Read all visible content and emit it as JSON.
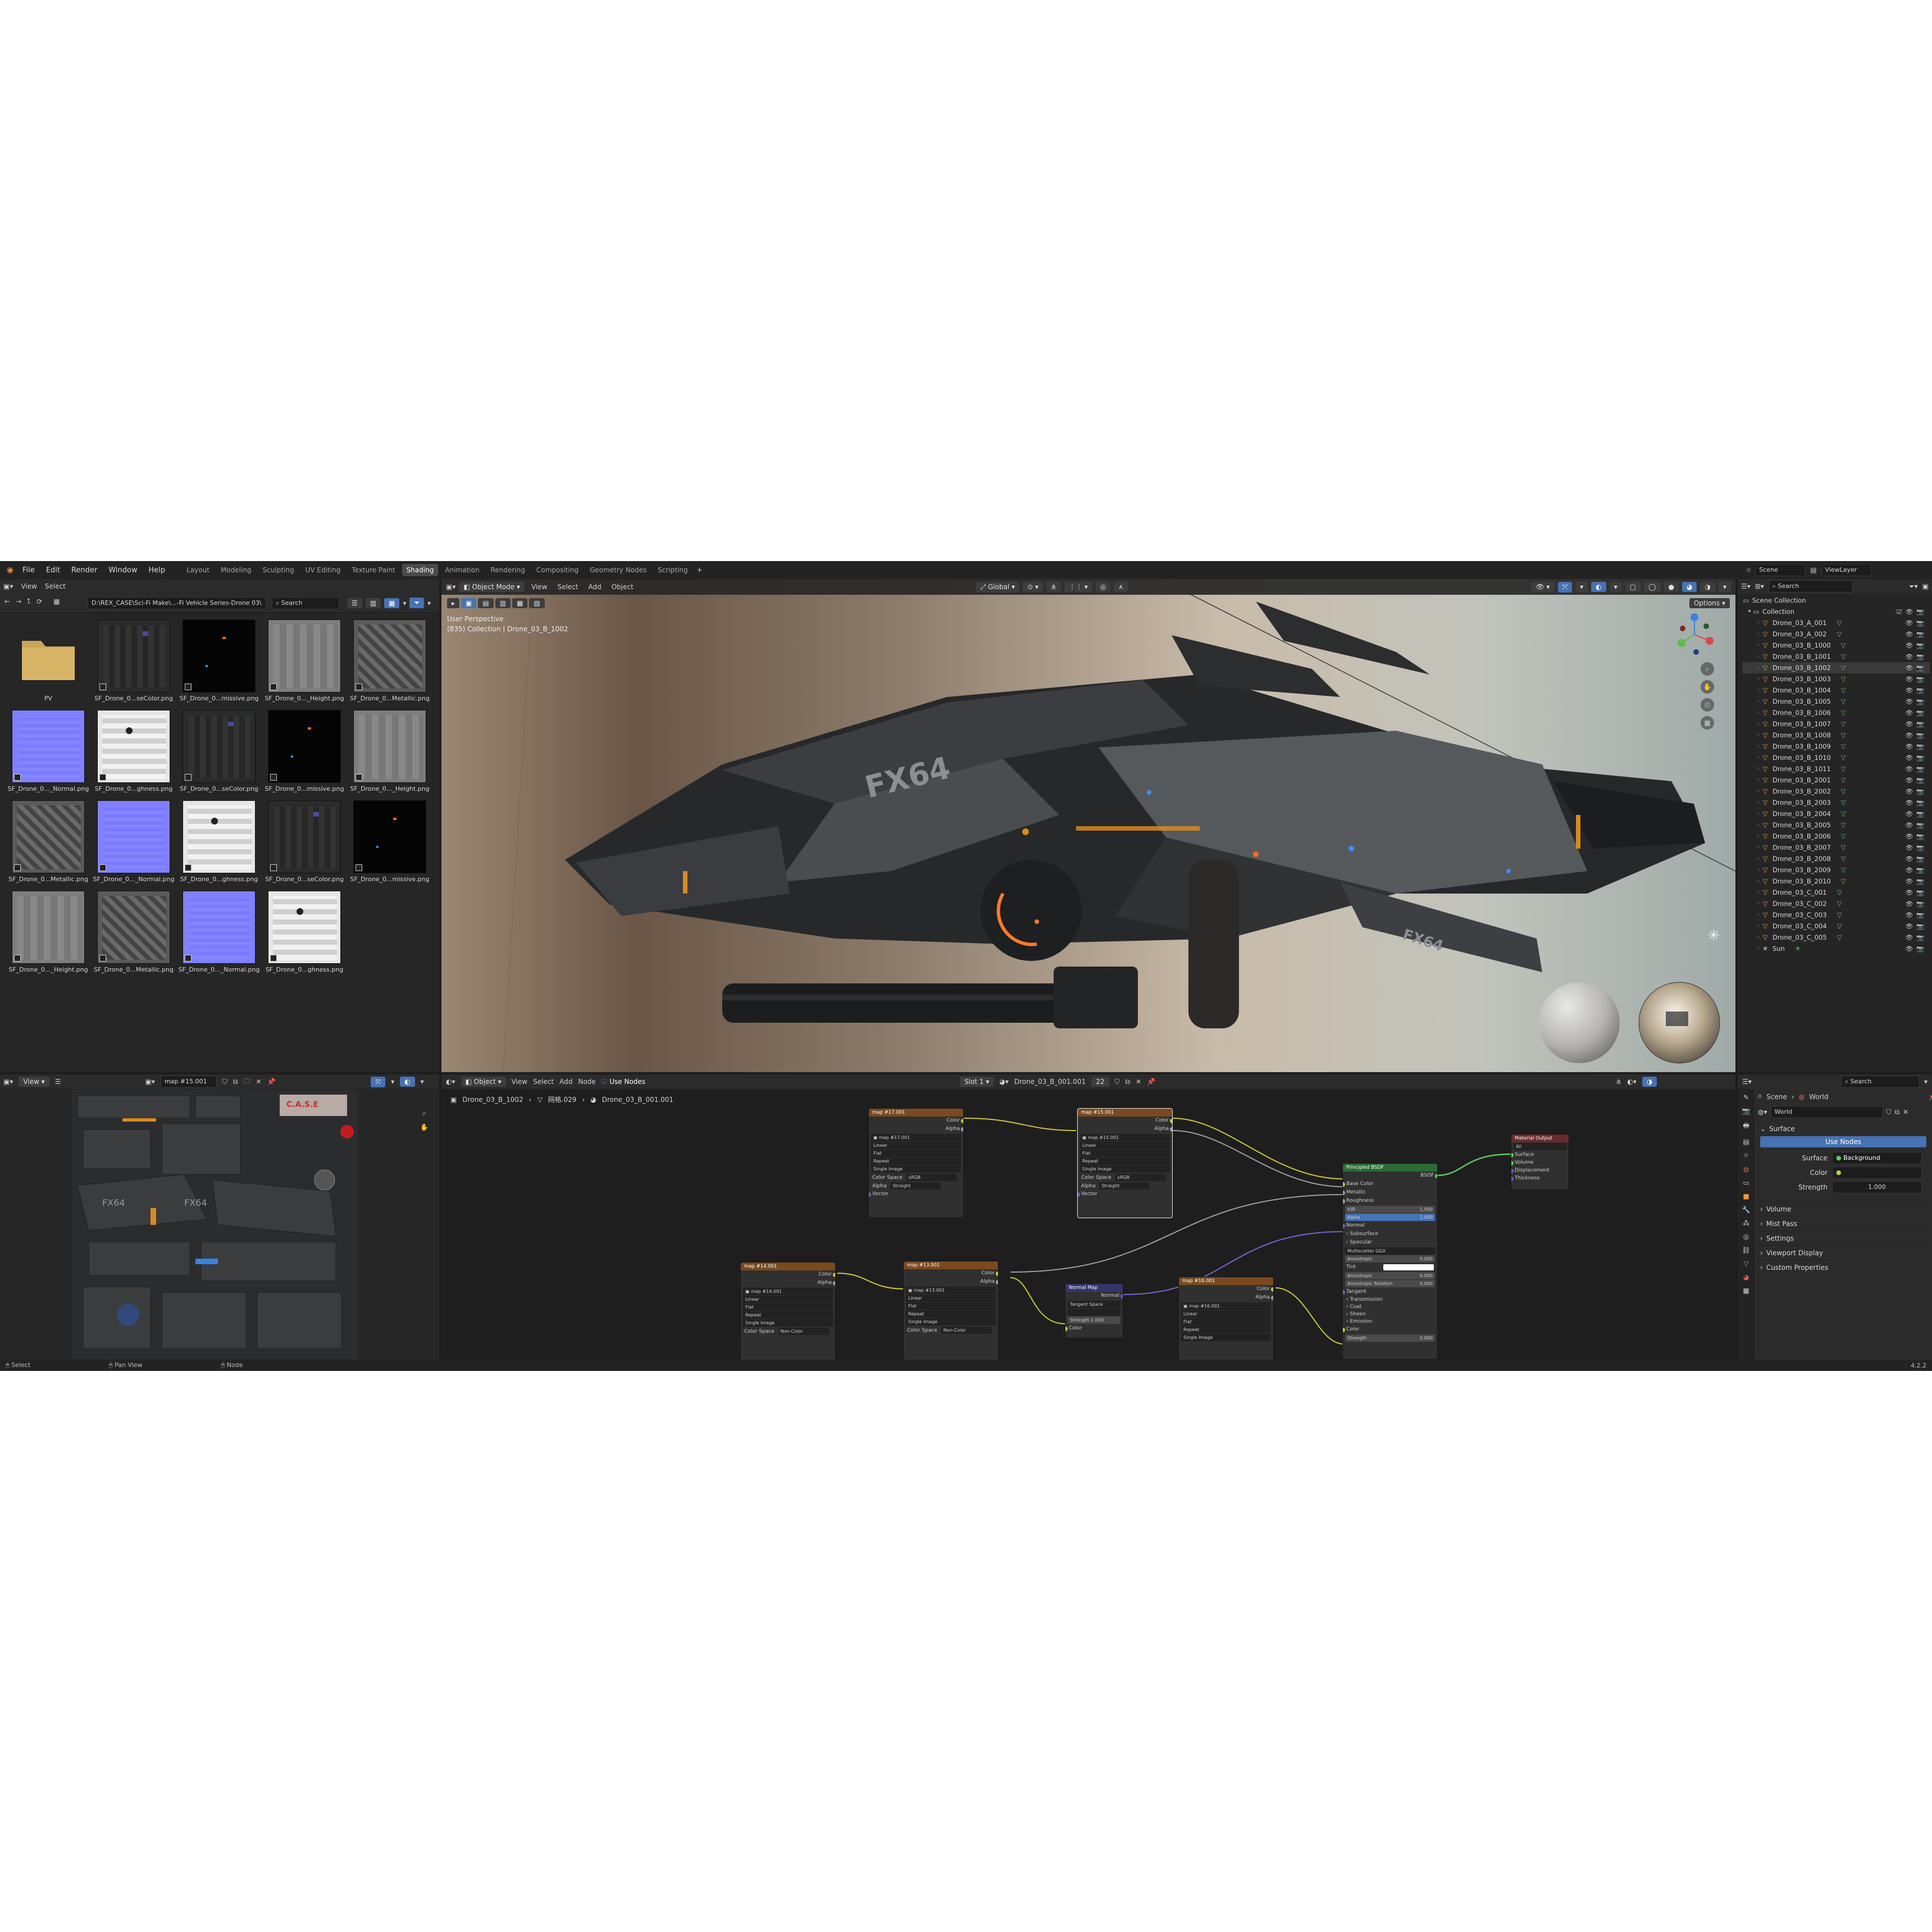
{
  "topbar": {
    "menus": [
      "File",
      "Edit",
      "Render",
      "Window",
      "Help"
    ],
    "workspaces": [
      "Layout",
      "Modeling",
      "Sculpting",
      "UV Editing",
      "Texture Paint",
      "Shading",
      "Animation",
      "Rendering",
      "Compositing",
      "Geometry Nodes",
      "Scripting"
    ],
    "active_workspace": "Shading",
    "scene_name": "Scene",
    "view_layer": "ViewLayer"
  },
  "file_browser": {
    "menus": [
      "View",
      "Select"
    ],
    "path": "D:\\REX_CASE\\Sci-Fi Make\\...-Fi Vehicle Series-Drone 03\\",
    "search_placeholder": "Search",
    "files": [
      {
        "label": "PV",
        "kind": "folder"
      },
      {
        "label": "SF_Drone_0...seColor.png",
        "kind": "base"
      },
      {
        "label": "SF_Drone_0...missive.png",
        "kind": "emissive"
      },
      {
        "label": "SF_Drone_0..._Height.png",
        "kind": "height"
      },
      {
        "label": "SF_Drone_0...Metallic.png",
        "kind": "metallic"
      },
      {
        "label": "SF_Drone_0..._Normal.png",
        "kind": "normal"
      },
      {
        "label": "SF_Drone_0...ghness.png",
        "kind": "rough"
      },
      {
        "label": "SF_Drone_0...seColor.png",
        "kind": "base"
      },
      {
        "label": "SF_Drone_0...missive.png",
        "kind": "emissive"
      },
      {
        "label": "SF_Drone_0..._Height.png",
        "kind": "height"
      },
      {
        "label": "SF_Drone_0...Metallic.png",
        "kind": "metallic"
      },
      {
        "label": "SF_Drone_0..._Normal.png",
        "kind": "normal"
      },
      {
        "label": "SF_Drone_0...ghness.png",
        "kind": "rough"
      },
      {
        "label": "SF_Drone_0...seColor.png",
        "kind": "base"
      },
      {
        "label": "SF_Drone_0...missive.png",
        "kind": "emissive"
      },
      {
        "label": "SF_Drone_0..._Height.png",
        "kind": "height"
      },
      {
        "label": "SF_Drone_0...Metallic.png",
        "kind": "metallic"
      },
      {
        "label": "SF_Drone_0..._Normal.png",
        "kind": "normal"
      },
      {
        "label": "SF_Drone_0...ghness.png",
        "kind": "rough"
      }
    ]
  },
  "viewport": {
    "mode": "Object Mode",
    "menus": [
      "View",
      "Select",
      "Add",
      "Object"
    ],
    "orientation": "Global",
    "options_label": "Options",
    "overlay_title": "User Perspective",
    "overlay_sub": "(835) Collection | Drone_03_B_1002",
    "hull_text": "FX64"
  },
  "outliner": {
    "search_placeholder": "Search",
    "scene_collection": "Scene Collection",
    "collection": "Collection",
    "items": [
      "Drone_03_A_001",
      "Drone_03_A_002",
      "Drone_03_B_1000",
      "Drone_03_B_1001",
      "Drone_03_B_1002",
      "Drone_03_B_1003",
      "Drone_03_B_1004",
      "Drone_03_B_1005",
      "Drone_03_B_1006",
      "Drone_03_B_1007",
      "Drone_03_B_1008",
      "Drone_03_B_1009",
      "Drone_03_B_1010",
      "Drone_03_B_1011",
      "Drone_03_B_2001",
      "Drone_03_B_2002",
      "Drone_03_B_2003",
      "Drone_03_B_2004",
      "Drone_03_B_2005",
      "Drone_03_B_2006",
      "Drone_03_B_2007",
      "Drone_03_B_2008",
      "Drone_03_B_2009",
      "Drone_03_B_2010",
      "Drone_03_C_001",
      "Drone_03_C_002",
      "Drone_03_C_003",
      "Drone_03_C_004",
      "Drone_03_C_005",
      "Sun"
    ]
  },
  "image_editor": {
    "view_menu": "View",
    "image_name": "map #15.001"
  },
  "node_editor": {
    "object_menu": "Object",
    "menus": [
      "View",
      "Select",
      "Add",
      "Node"
    ],
    "use_nodes": "Use Nodes",
    "slot": "Slot 1",
    "material": "Drone_03_B_001.001",
    "users": "22",
    "breadcrumb": [
      "Drone_03_B_1002",
      "网格.029",
      "Drone_03_B_001.001"
    ],
    "nodes": {
      "img1": {
        "title": "map #17.001",
        "img": "map #17.001",
        "rows": [
          "Linear",
          "Flat",
          "Repeat",
          "Single Image"
        ],
        "cs_label": "Color Space",
        "cs_value": "sRGB",
        "alpha_label": "Alpha",
        "alpha_value": "Straight",
        "vector": "Vector",
        "out1": "Color",
        "out2": "Alpha"
      },
      "img2": {
        "title": "map #15.001",
        "img": "map #15.001",
        "rows": [
          "Linear",
          "Flat",
          "Repeat",
          "Single Image"
        ],
        "cs_label": "Color Space",
        "cs_value": "sRGB",
        "alpha_label": "Alpha",
        "alpha_value": "Straight",
        "vector": "Vector",
        "out1": "Color",
        "out2": "Alpha"
      },
      "img3": {
        "title": "map #14.001",
        "img": "map #14.001",
        "rows": [
          "Linear",
          "Flat",
          "Repeat",
          "Single Image"
        ],
        "cs_label": "Color Space",
        "cs_value": "Non-Color",
        "out1": "Color",
        "out2": "Alpha"
      },
      "img4": {
        "title": "map #13.001",
        "img": "map #13.001",
        "rows": [
          "Linear",
          "Flat",
          "Repeat",
          "Single Image"
        ],
        "cs_label": "Color Space",
        "cs_value": "Non-Color",
        "out1": "Color",
        "out2": "Alpha"
      },
      "img5": {
        "title": "map #16.001",
        "img": "map #16.001",
        "rows": [
          "Linear",
          "Flat",
          "Repeat",
          "Single Image"
        ],
        "out1": "Color",
        "out2": "Alpha"
      },
      "normal": {
        "title": "Normal Map",
        "out": "Normal",
        "space": "Tangent Space",
        "strength_label": "Strength",
        "strength_value": "1.000",
        "color": "Color"
      },
      "bsdf": {
        "title": "Principled BSDF",
        "out": "BSDF",
        "inputs": [
          "Base Color",
          "Metallic",
          "Roughness"
        ],
        "ior_label": "IOR",
        "ior_value": "1.500",
        "alpha_label": "Alpha",
        "alpha_value": "1.000",
        "more": [
          "Normal",
          "Subsurface",
          "Specular"
        ],
        "distribution": "Multiscatter GGX",
        "aniso_label": "Anisotropic",
        "aniso_value": "0.000",
        "tint_label": "Tint",
        "aniso2": "Anisotropic",
        "aniso2_value": "0.000",
        "rot_label": "Anisotropic Rotation",
        "rot_value": "0.000",
        "tangent": "Tangent",
        "sections": [
          "Transmission",
          "Coat",
          "Sheen",
          "Emission"
        ],
        "color": "Color",
        "strength_label": "Strength",
        "strength_value": "0.000"
      },
      "output": {
        "title": "Material Output",
        "target": "All",
        "inputs": [
          "Surface",
          "Volume",
          "Displacement",
          "Thickness"
        ]
      }
    }
  },
  "properties": {
    "breadcrumb": [
      "Scene",
      "World"
    ],
    "world_name": "World",
    "surface_header": "Surface",
    "use_nodes": "Use Nodes",
    "surface_label": "Surface",
    "surface_value": "Background",
    "color_label": "Color",
    "strength_label": "Strength",
    "strength_value": "1.000",
    "panels": [
      "Volume",
      "Mist Pass",
      "Settings",
      "Viewport Display",
      "Custom Properties"
    ],
    "search_placeholder": "Search"
  },
  "status": {
    "select": "Select",
    "pan": "Pan View",
    "node": "Node",
    "version": "4.2.2"
  },
  "colors": {
    "accent": "#4772b3",
    "node_image_header": "#7a4a1f",
    "node_bsdf_header": "#2c6b34",
    "node_output_header": "#6b2a2a",
    "node_vector_header": "#35356b",
    "wire_yellow": "#c8c83a",
    "wire_green": "#5ec85e",
    "wire_purple": "#7766d0",
    "wire_gray": "#a0a0a0"
  }
}
